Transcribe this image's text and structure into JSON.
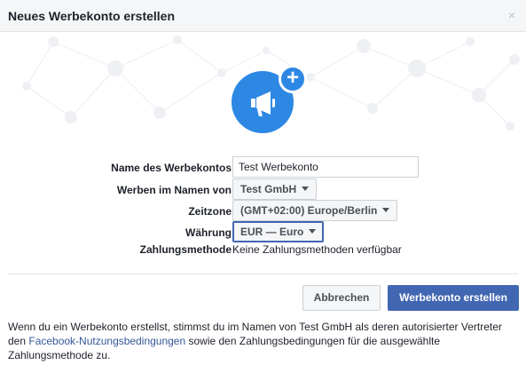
{
  "dialog": {
    "title": "Neues Werbekonto erstellen",
    "close_glyph": "×"
  },
  "hero": {
    "icon": "megaphone-icon",
    "badge": "+",
    "accent_color": "#2d88e4"
  },
  "form": {
    "account_name": {
      "label": "Name des Werbekontos",
      "value": "Test Werbekonto"
    },
    "advertise_for": {
      "label": "Werben im Namen von",
      "value": "Test GmbH"
    },
    "timezone": {
      "label": "Zeitzone",
      "value": "(GMT+02:00) Europe/Berlin"
    },
    "currency": {
      "label": "Währung",
      "value": "EUR — Euro"
    },
    "payment_method": {
      "label": "Zahlungsmethode",
      "value": "Keine Zahlungsmethoden verfügbar"
    }
  },
  "buttons": {
    "cancel": "Abbrechen",
    "create": "Werbekonto erstellen",
    "primary_color": "#4267b2"
  },
  "footer": {
    "text_before": "Wenn du ein Werbekonto erstellst, stimmst du im Namen von Test GmbH als deren autorisierter Vertreter den ",
    "link": "Facebook-Nutzungsbedingungen",
    "text_after": " sowie den Zahlungsbedingungen für die ausgewählte Zahlungsmethode zu."
  }
}
